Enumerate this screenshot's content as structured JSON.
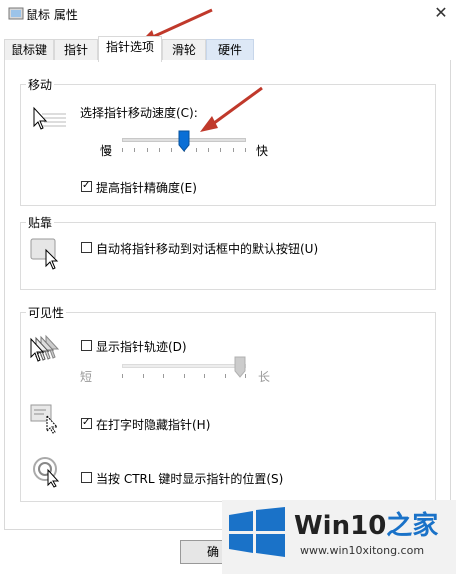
{
  "window": {
    "title": "鼠标 属性",
    "close_glyph": "✕"
  },
  "tabs": [
    {
      "label": "鼠标键"
    },
    {
      "label": "指针"
    },
    {
      "label": "指针选项"
    },
    {
      "label": "滑轮"
    },
    {
      "label": "硬件"
    }
  ],
  "active_tab": "指针选项",
  "motion": {
    "group_label": "移动",
    "speed_label": "选择指针移动速度(C):",
    "slow_label": "慢",
    "fast_label": "快",
    "speed_value_fraction": 0.5,
    "precision_label": "提高指针精确度(E)",
    "precision_checked": true
  },
  "snap": {
    "group_label": "贴靠",
    "snap_label": "自动将指针移动到对话框中的默认按钮(U)",
    "snap_checked": false
  },
  "visibility": {
    "group_label": "可见性",
    "trails_label": "显示指针轨迹(D)",
    "trails_checked": false,
    "short_label": "短",
    "long_label": "长",
    "trails_value_fraction": 1.0,
    "hide_typing_label": "在打字时隐藏指针(H)",
    "hide_typing_checked": true,
    "ctrl_label": "当按 CTRL 键时显示指针的位置(S)",
    "ctrl_checked": false
  },
  "buttons": {
    "ok_label": "确"
  },
  "watermark": {
    "title_a": "Win10",
    "title_b": "之家",
    "url": "www.win10xitong.com"
  },
  "colors": {
    "slider_thumb": "#0a6fd6",
    "arrow": "#c0392b",
    "watermark_blue": "#1a72c8"
  }
}
